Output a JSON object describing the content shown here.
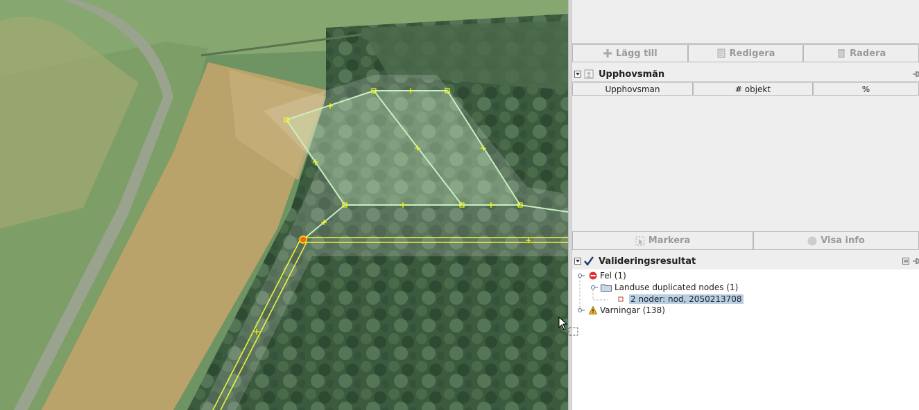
{
  "top_buttons": {
    "add_label": "Lägg till",
    "edit_label": "Redigera",
    "delete_label": "Radera"
  },
  "authors": {
    "title": "Upphovsmän",
    "columns": [
      "Upphovsman",
      "# objekt",
      "%"
    ],
    "select_label": "Markera",
    "info_label": "Visa info"
  },
  "validation": {
    "title": "Valideringsresultat",
    "errors_label": "Fel (1)",
    "group_label": "Landuse duplicated nodes (1)",
    "item_label": "2 noder: nod, 2050213708",
    "warnings_label": "Varningar (138)"
  },
  "colors": {
    "selection": "#b8cfe5",
    "way_highlight": "#ffff00",
    "landuse": "#c8f0c0"
  }
}
